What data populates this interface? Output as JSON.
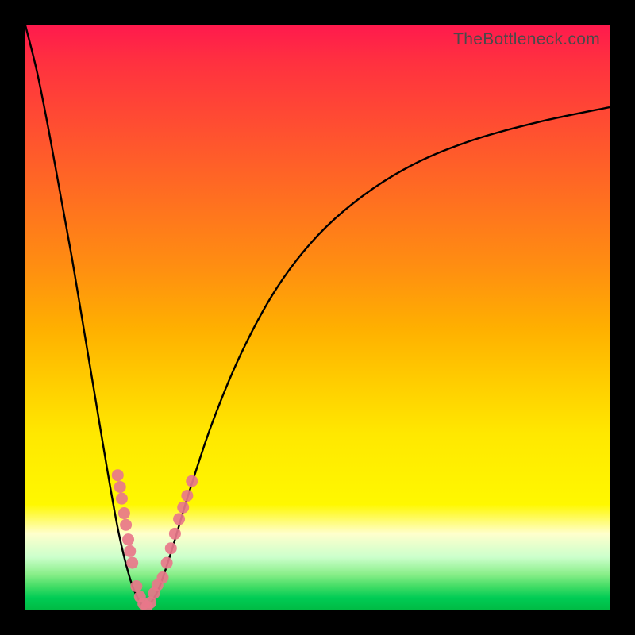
{
  "watermark": "TheBottleneck.com",
  "chart_data": {
    "type": "line",
    "title": "",
    "xlabel": "",
    "ylabel": "",
    "xlim": [
      0,
      100
    ],
    "ylim": [
      0,
      100
    ],
    "series": [
      {
        "name": "bottleneck-curve",
        "x": [
          0,
          2,
          4,
          6,
          8,
          10,
          12,
          14,
          16,
          18,
          19.5,
          20.5,
          21.5,
          23,
          25,
          28,
          32,
          37,
          43,
          50,
          58,
          67,
          77,
          88,
          100
        ],
        "values": [
          100,
          92,
          82,
          71,
          60,
          48,
          36,
          24,
          13,
          5,
          1.5,
          0.5,
          1.2,
          4,
          10,
          20,
          32,
          44,
          55,
          64,
          71,
          76.5,
          80.5,
          83.5,
          86
        ]
      }
    ],
    "markers": {
      "left_cluster": {
        "x_range": [
          15.5,
          18.5
        ],
        "y_range": [
          7,
          24
        ],
        "points": [
          [
            15.8,
            23.0
          ],
          [
            16.2,
            21.0
          ],
          [
            16.5,
            19.0
          ],
          [
            16.9,
            16.5
          ],
          [
            17.2,
            14.5
          ],
          [
            17.6,
            12.0
          ],
          [
            17.9,
            10.0
          ],
          [
            18.3,
            8.0
          ]
        ]
      },
      "right_cluster": {
        "x_range": [
          23.5,
          29.0
        ],
        "y_range": [
          4,
          23
        ],
        "points": [
          [
            23.5,
            5.5
          ],
          [
            24.2,
            8.0
          ],
          [
            24.9,
            10.5
          ],
          [
            25.6,
            13.0
          ],
          [
            26.3,
            15.5
          ],
          [
            27.0,
            17.5
          ],
          [
            27.7,
            19.5
          ],
          [
            28.5,
            22.0
          ]
        ]
      },
      "bottom_cluster": {
        "x_range": [
          19.0,
          22.5
        ],
        "y_range": [
          0.4,
          4.5
        ],
        "points": [
          [
            19.0,
            4.0
          ],
          [
            19.6,
            2.2
          ],
          [
            20.2,
            1.0
          ],
          [
            20.8,
            0.5
          ],
          [
            21.4,
            1.2
          ],
          [
            22.0,
            2.8
          ],
          [
            22.6,
            4.2
          ]
        ]
      }
    },
    "background_gradient": {
      "direction": "vertical",
      "stops": [
        {
          "pos": 0.0,
          "color": "#ff1a4d"
        },
        {
          "pos": 0.3,
          "color": "#ff7020"
        },
        {
          "pos": 0.62,
          "color": "#ffd000"
        },
        {
          "pos": 0.82,
          "color": "#fff800"
        },
        {
          "pos": 0.94,
          "color": "#44dd66"
        },
        {
          "pos": 1.0,
          "color": "#00bb44"
        }
      ]
    },
    "marker_color": "#e8778a",
    "curve_color": "#000000"
  }
}
